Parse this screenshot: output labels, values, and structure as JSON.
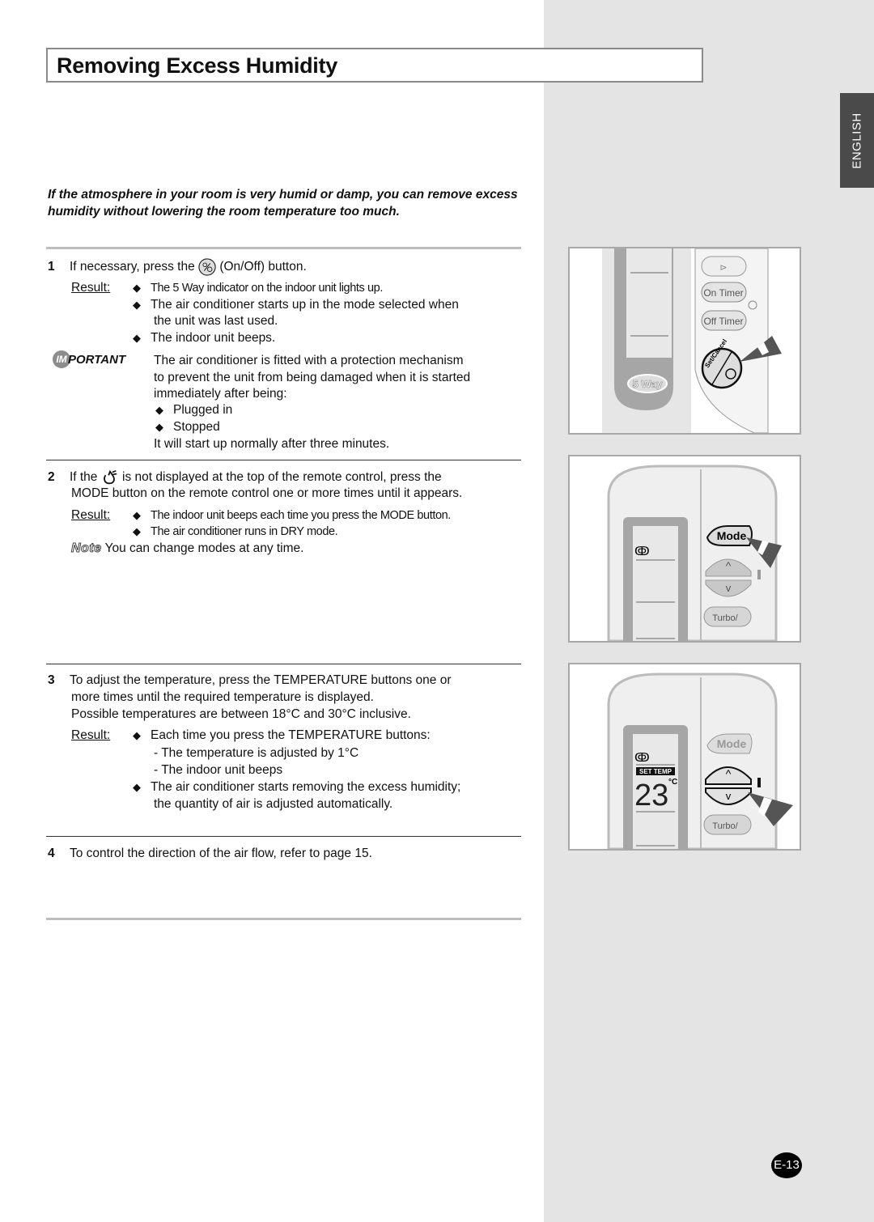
{
  "page": {
    "title": "Removing Excess Humidity",
    "language_tab": "ENGLISH",
    "page_number": "E-13",
    "intro": "If the atmosphere in your room is very humid or damp, you can remove excess humidity without lowering the room temperature too much."
  },
  "steps": [
    {
      "number": "1",
      "text_before_icon": "If necessary, press the",
      "icon": "on-off-button-icon",
      "text_after_icon": "(On/Off) button.",
      "result_label": "Result:",
      "results": [
        "The 5 Way indicator on the indoor unit lights up.",
        "The air conditioner starts up in the mode selected when",
        "the unit was last used.",
        "The indoor unit beeps."
      ],
      "important": {
        "label_circle": "IM",
        "label_rest": "PORTANT",
        "lines": [
          "The air conditioner is fitted with a protection mechanism",
          "to prevent the unit from being damaged when it is started",
          "immediately after being:"
        ],
        "bullets": [
          "Plugged in",
          "Stopped"
        ],
        "closing": "It will start up normally after three minutes."
      }
    },
    {
      "number": "2",
      "text_before_icon": "If the",
      "icon": "dry-mode-icon",
      "text_after_icon": "is not displayed at the top of the remote control, press the",
      "line2": "MODE button on the remote control one or more times until it appears.",
      "result_label": "Result:",
      "results": [
        "The indoor unit beeps each time you press the MODE button.",
        "The air conditioner runs in DRY mode."
      ],
      "note_label": "Note",
      "note_text": "You can change modes at any time."
    },
    {
      "number": "3",
      "lines": [
        "To adjust the temperature, press the TEMPERATURE buttons one or",
        "more times until the required temperature is displayed.",
        "Possible temperatures are between 18°C and 30°C inclusive."
      ],
      "result_label": "Result:",
      "results": [
        "Each time you press the TEMPERATURE buttons:",
        "- The temperature is adjusted by 1°C",
        "- The indoor unit beeps",
        "The air conditioner starts removing the excess humidity;",
        "the quantity of air is adjusted automatically."
      ]
    },
    {
      "number": "4",
      "text": "To control the direction of the air flow, refer to page 15."
    }
  ],
  "figures": {
    "fig1": {
      "five_way": "5 Way",
      "on_timer": "On Timer",
      "off_timer": "Off Timer",
      "set_cancel": "Set/Cancel"
    },
    "fig2": {
      "mode": "Mode",
      "turbo": "Turbo/"
    },
    "fig3": {
      "mode": "Mode",
      "set_temp": "SET TEMP",
      "temperature": "23",
      "unit": "°C",
      "turbo": "Turbo/"
    }
  },
  "colors": {
    "side_panel": "#e4e4e4",
    "language_tab": "#4a4a4a",
    "arrow": "#555555"
  }
}
